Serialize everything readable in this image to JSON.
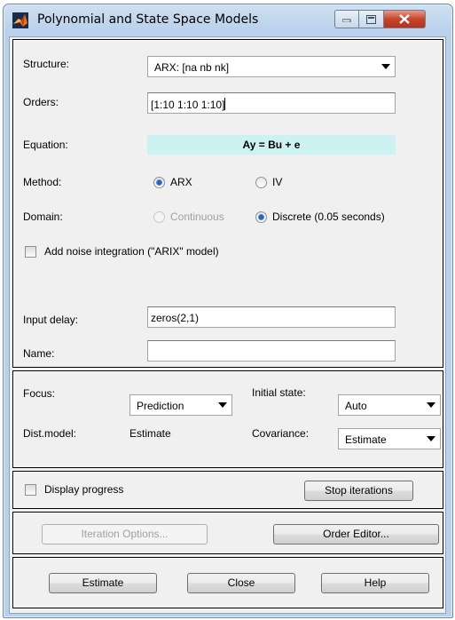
{
  "window": {
    "title": "Polynomial and State Space Models",
    "controls": {
      "minimize": "minimize",
      "maximize": "maximize",
      "close": "close"
    }
  },
  "model": {
    "structure_label": "Structure:",
    "structure_value": "ARX: [na nb nk]",
    "orders_label": "Orders:",
    "orders_value": "[1:10 1:10 1:10]",
    "equation_label": "Equation:",
    "equation_value": "Ay = Bu + e",
    "method_label": "Method:",
    "method_options": [
      "ARX",
      "IV"
    ],
    "method_selected": "ARX",
    "domain_label": "Domain:",
    "domain_options": [
      "Continuous",
      "Discrete (0.05 seconds)"
    ],
    "domain_selected": "Discrete (0.05 seconds)",
    "noise_integration_label": "Add noise integration (\"ARIX\" model)",
    "input_delay_label": "Input delay:",
    "input_delay_value": "zeros(2,1)",
    "name_label": "Name:",
    "name_value": ""
  },
  "options": {
    "focus_label": "Focus:",
    "focus_value": "Prediction",
    "initial_state_label": "Initial state:",
    "initial_state_value": "Auto",
    "dist_model_label": "Dist.model:",
    "dist_model_value": "Estimate",
    "covariance_label": "Covariance:",
    "covariance_value": "Estimate"
  },
  "progress": {
    "display_progress_label": "Display progress",
    "stop_iterations_label": "Stop iterations"
  },
  "editors": {
    "iteration_options_label": "Iteration Options...",
    "order_editor_label": "Order Editor..."
  },
  "actions": {
    "estimate_label": "Estimate",
    "close_label": "Close",
    "help_label": "Help"
  },
  "colors": {
    "equation_bg": "#ccf2f2",
    "titlebar": "#b9d1ea",
    "close_button": "#c7442b"
  }
}
